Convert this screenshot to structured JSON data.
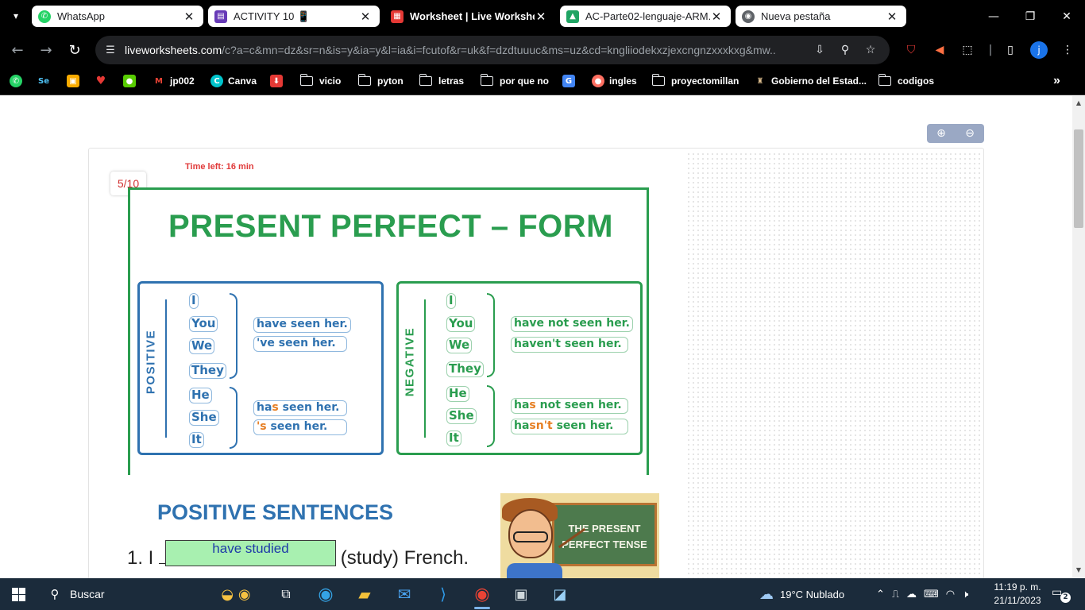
{
  "browser": {
    "tabs": [
      {
        "title": "WhatsApp",
        "favicon": "whatsapp-icon",
        "color": "#25d366"
      },
      {
        "title": "ACTIVITY 10 📱",
        "favicon": "form-icon",
        "color": "#673ab7"
      },
      {
        "title": "Worksheet | Live Workshee",
        "favicon": "liveworksheets-icon",
        "color": "#e53935"
      },
      {
        "title": "AC-Parte02-lenguaje-ARM.p",
        "favicon": "drive-icon",
        "color": "#1fa463"
      },
      {
        "title": "Nueva pestaña",
        "favicon": "chrome-icon",
        "color": "#5f6368"
      }
    ],
    "active_tab_index": 2,
    "url_host": "liveworksheets.com",
    "url_path": "/c?a=c&mn=dz&sr=n&is=y&ia=y&l=ia&i=fcutof&r=uk&f=dzdtuuuc&ms=uz&cd=kngliiodekxzjexcngnzxxxkxg&mw...",
    "profile_initial": "j",
    "bookmarks": [
      {
        "label": "",
        "icon": "whatsapp-icon"
      },
      {
        "label": "",
        "icon": "se-icon"
      },
      {
        "label": "",
        "icon": "classroom-icon"
      },
      {
        "label": "",
        "icon": "heart-icon"
      },
      {
        "label": "",
        "icon": "owl-icon"
      },
      {
        "label": "jp002",
        "icon": "gmail-icon"
      },
      {
        "label": "Canva",
        "icon": "canva-icon"
      },
      {
        "label": "",
        "icon": "download-icon"
      },
      {
        "label": "vicio",
        "icon": "folder-icon"
      },
      {
        "label": "pyton",
        "icon": "folder-icon"
      },
      {
        "label": "letras",
        "icon": "folder-icon"
      },
      {
        "label": "por que no",
        "icon": "folder-icon"
      },
      {
        "label": "",
        "icon": "translate-icon"
      },
      {
        "label": "ingles",
        "icon": "ingles-icon"
      },
      {
        "label": "proyectomillan",
        "icon": "folder-icon"
      },
      {
        "label": "Gobierno del Estad...",
        "icon": "government-icon"
      },
      {
        "label": "codigos",
        "icon": "folder-icon"
      }
    ]
  },
  "worksheet": {
    "time_left": "Time left: 16 min",
    "score": "5/10",
    "chart_title": "PRESENT PERFECT – FORM",
    "positive": {
      "label": "POSITIVE",
      "group1_pronouns": [
        "I",
        "You",
        "We",
        "They"
      ],
      "group1_phrases": [
        "have seen her.",
        "'ve seen her."
      ],
      "group2_pronouns": [
        "He",
        "She",
        "It"
      ],
      "group2_phrase1": [
        "ha",
        "s",
        " seen her."
      ],
      "group2_phrase2": [
        "'s",
        " seen her."
      ]
    },
    "negative": {
      "label": "NEGATIVE",
      "group1_pronouns": [
        "I",
        "You",
        "We",
        "They"
      ],
      "group1_phrases": [
        "have not seen her.",
        "haven't seen her."
      ],
      "group2_pronouns": [
        "He",
        "She",
        "It"
      ],
      "group2_phrase1": [
        "ha",
        "s",
        " not seen her."
      ],
      "group2_phrase2": [
        "ha",
        "sn't",
        " seen her."
      ]
    },
    "section_title": "POSITIVE SENTENCES",
    "question1": {
      "prefix": "1. I",
      "answer": "have studied",
      "suffix": "(study) French."
    },
    "image_text_line1": "THE PRESENT",
    "image_text_line2": "PERFECT TENSE"
  },
  "taskbar": {
    "search_placeholder": "Buscar",
    "weather": "19°C  Nublado",
    "time": "11:19 p. m.",
    "date": "21/11/2023",
    "notification_count": "2",
    "apps": [
      "task-view-icon",
      "edge-icon",
      "file-explorer-icon",
      "mail-icon",
      "vscode-icon",
      "chrome-icon",
      "app-icon",
      "app2-icon"
    ]
  }
}
